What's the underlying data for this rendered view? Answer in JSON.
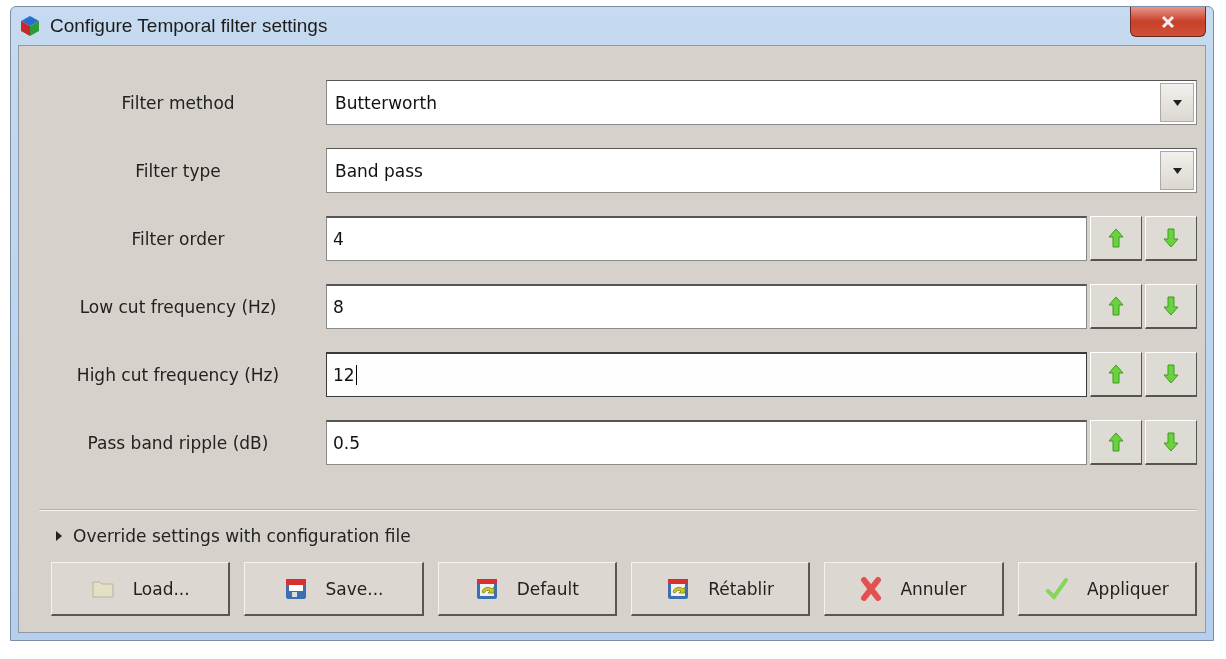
{
  "window": {
    "title": "Configure Temporal filter settings"
  },
  "fields": [
    {
      "label": "Filter method",
      "kind": "dropdown",
      "value": "Butterworth",
      "focused": false
    },
    {
      "label": "Filter type",
      "kind": "dropdown",
      "value": "Band pass",
      "focused": false
    },
    {
      "label": "Filter order",
      "kind": "spin",
      "value": "4",
      "focused": false
    },
    {
      "label": "Low cut frequency (Hz)",
      "kind": "spin",
      "value": "8",
      "focused": false
    },
    {
      "label": "High cut frequency (Hz)",
      "kind": "spin",
      "value": "12",
      "focused": true
    },
    {
      "label": "Pass band ripple (dB)",
      "kind": "spin",
      "value": "0.5",
      "focused": false
    }
  ],
  "expander": {
    "label": "Override settings with configuration file",
    "expanded": false
  },
  "buttons": [
    {
      "label": "Load..."
    },
    {
      "label": "Save..."
    },
    {
      "label": "Default"
    },
    {
      "label": "Rétablir"
    },
    {
      "label": "Annuler"
    },
    {
      "label": "Appliquer"
    }
  ]
}
